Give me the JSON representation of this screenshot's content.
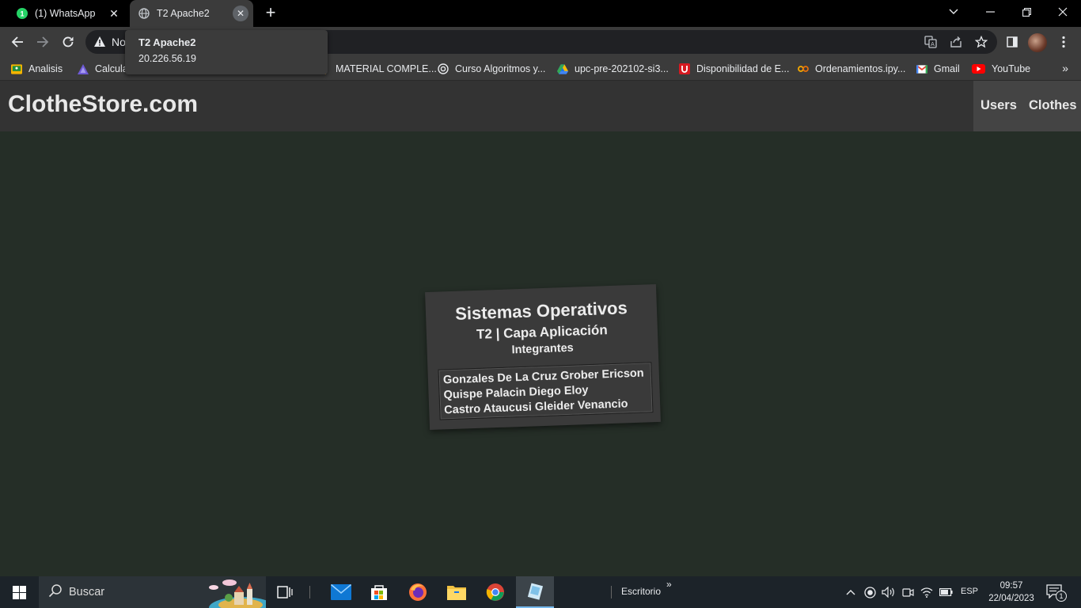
{
  "browser": {
    "tabs": [
      {
        "label": "(1) WhatsApp",
        "favicon": "whatsapp-icon",
        "badge": "1"
      },
      {
        "label": "T2 Apache2",
        "favicon": "globe-icon",
        "active": true
      }
    ],
    "tooltip": {
      "title": "T2 Apache2",
      "url": "20.226.56.19"
    },
    "omnibox": {
      "security_text": "No"
    },
    "bookmarks": [
      {
        "label": "Analisis",
        "icon": "classroom-icon"
      },
      {
        "label": "Calcula",
        "icon": "triangle-icon"
      },
      {
        "label": "MATERIAL COMPLE...",
        "icon": "folder-icon"
      },
      {
        "label": "Curso Algoritmos y...",
        "icon": "openai-icon"
      },
      {
        "label": "upc-pre-202102-si3...",
        "icon": "drive-icon"
      },
      {
        "label": "Disponibilidad de E...",
        "icon": "upc-icon"
      },
      {
        "label": "Ordenamientos.ipy...",
        "icon": "colab-icon"
      },
      {
        "label": "Gmail",
        "icon": "gmail-icon"
      },
      {
        "label": "YouTube",
        "icon": "youtube-icon"
      }
    ],
    "bookmarks_more": "»"
  },
  "site": {
    "title": "ClotheStore.com",
    "nav": [
      "Users",
      "Clothes"
    ]
  },
  "card": {
    "title": "Sistemas Operativos",
    "subtitle": "T2 | Capa Aplicación",
    "heading": "Integrantes",
    "members": [
      "Gonzales De La Cruz Grober Ericson",
      "Quispe Palacin Diego Eloy",
      "Castro Ataucusi Gleider Venancio"
    ]
  },
  "taskbar": {
    "search_placeholder": "Buscar",
    "desktop_label": "Escritorio",
    "desktop_chevron": "»",
    "language": "ESP",
    "time": "09:57",
    "date": "22/04/2023",
    "notification_count": "1"
  },
  "colors": {
    "page_background": "#252e27",
    "site_header": "#333333",
    "card_background": "#3a3a3a",
    "browser_chrome": "#3b3b3b",
    "taskbar": "#1c2329"
  }
}
